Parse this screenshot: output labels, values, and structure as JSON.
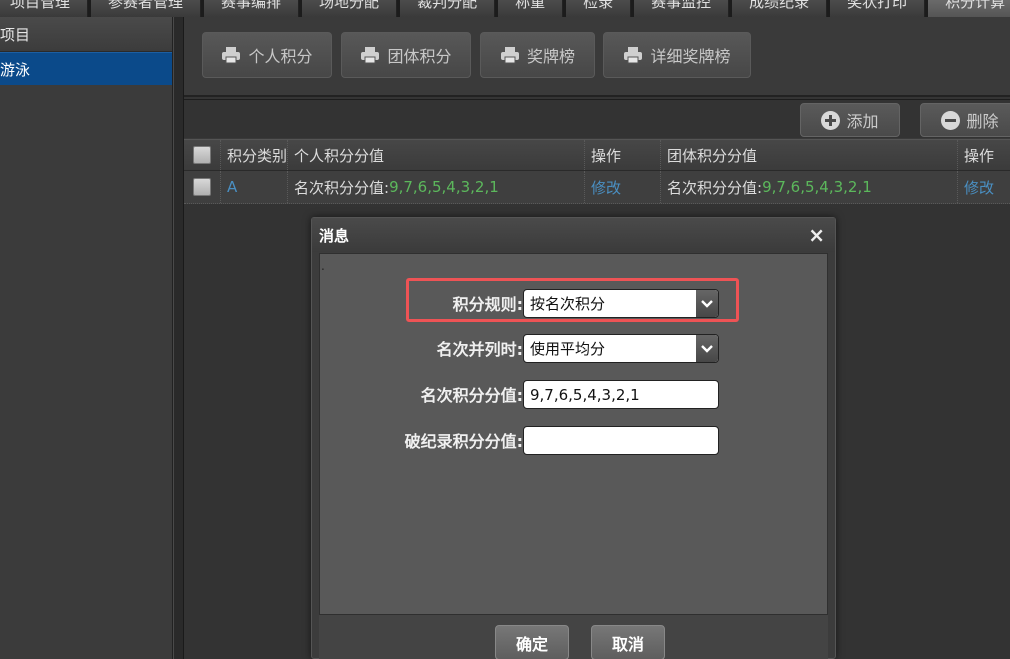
{
  "topnav": {
    "tabs": [
      {
        "label": "项目管理"
      },
      {
        "label": "参赛者管理"
      },
      {
        "label": "赛事编排"
      },
      {
        "label": "场地分配"
      },
      {
        "label": "裁判分配"
      },
      {
        "label": "称重"
      },
      {
        "label": "检录"
      },
      {
        "label": "赛事监控"
      },
      {
        "label": "成绩纪录"
      },
      {
        "label": "奖状打印"
      },
      {
        "label": "积分计算"
      }
    ],
    "active_index": 10
  },
  "sidebar": {
    "header": "项目",
    "items": [
      {
        "label": "游泳"
      }
    ]
  },
  "toolbar": {
    "buttons": [
      {
        "label": "个人积分",
        "icon": "printer-icon"
      },
      {
        "label": "团体积分",
        "icon": "printer-icon"
      },
      {
        "label": "奖牌榜",
        "icon": "printer-icon"
      },
      {
        "label": "详细奖牌榜",
        "icon": "printer-icon"
      }
    ]
  },
  "grid": {
    "add_label": "添加",
    "delete_label": "删除",
    "columns": [
      "积分类别",
      "个人积分分值",
      "操作",
      "团体积分分值",
      "操作"
    ],
    "rows": [
      {
        "category": "A",
        "personal_prefix": "名次积分分值:",
        "personal_value": "9,7,6,5,4,3,2,1",
        "personal_action": "修改",
        "team_prefix": "名次积分分值:",
        "team_value": "9,7,6,5,4,3,2,1",
        "team_action": "修改"
      }
    ]
  },
  "modal": {
    "title": "消息",
    "close_glyph": "×",
    "dot": ".",
    "fields": [
      {
        "label": "积分规则:",
        "value": "按名次积分",
        "type": "select"
      },
      {
        "label": "名次并列时:",
        "value": "使用平均分",
        "type": "select"
      },
      {
        "label": "名次积分分值:",
        "value": "9,7,6,5,4,3,2,1",
        "type": "input"
      },
      {
        "label": "破纪录积分分值:",
        "value": "",
        "type": "input"
      }
    ],
    "ok_label": "确定",
    "cancel_label": "取消"
  },
  "colors": {
    "highlight": "#ee5355",
    "selected_item": "#0b4a8a",
    "link": "#4a8fc2",
    "value_green": "#5cb85c"
  }
}
